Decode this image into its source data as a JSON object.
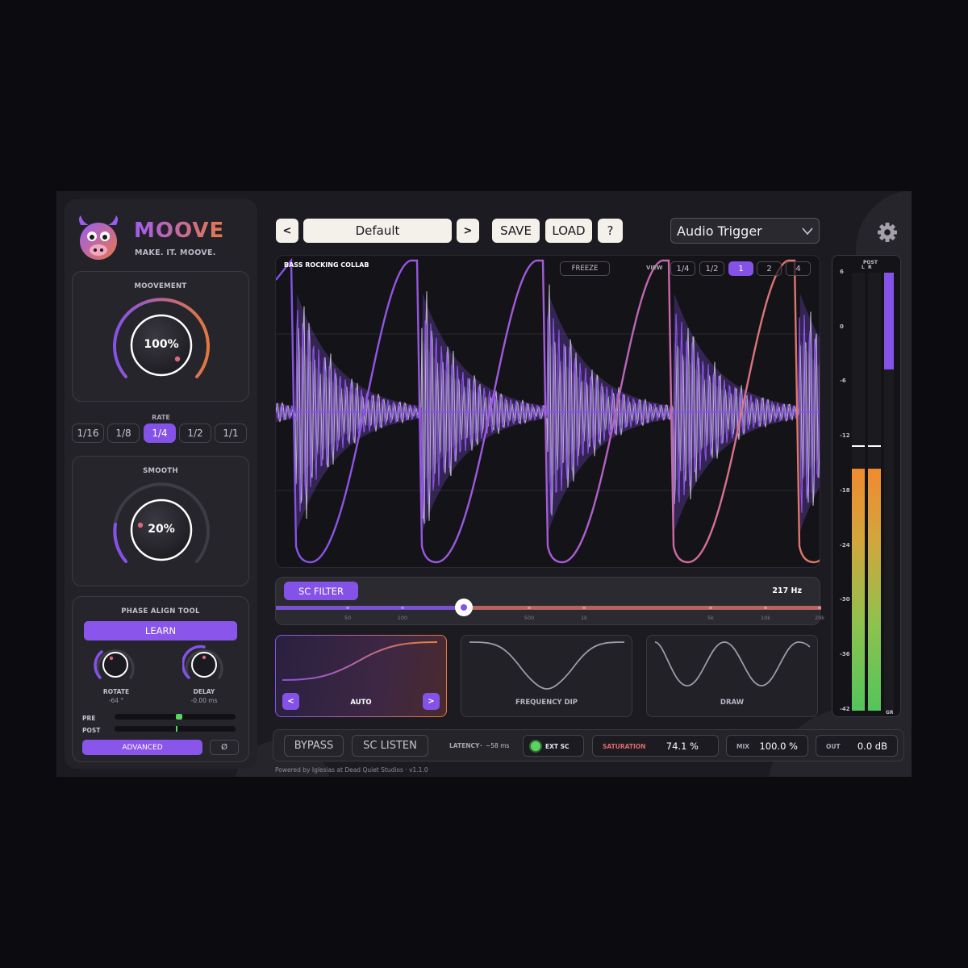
{
  "brand": {
    "name": "MOOVE",
    "tagline": "MAKE. IT. MOOVE."
  },
  "movement": {
    "title": "MOOVEMENT",
    "value": "100%",
    "level": 1.0
  },
  "rate": {
    "label": "RATE",
    "options": [
      "1/16",
      "1/8",
      "1/4",
      "1/2",
      "1/1"
    ],
    "selected": "1/4"
  },
  "smooth": {
    "title": "SMOOTH",
    "value": "20%",
    "level": 0.2
  },
  "phase": {
    "title": "PHASE ALIGN TOOL",
    "learn": "LEARN",
    "rotate": {
      "label": "ROTATE",
      "value": "-64 °"
    },
    "delay": {
      "label": "DELAY",
      "value": "-0.00 ms"
    },
    "pre": "PRE",
    "post": "POST",
    "advanced": "ADVANCED",
    "phase_invert": "Ø"
  },
  "toolbar": {
    "prev": "<",
    "preset": "Default",
    "next": ">",
    "save": "SAVE",
    "load": "LOAD",
    "help": "?"
  },
  "trigger": {
    "selected": "Audio Trigger"
  },
  "waveform": {
    "title": "BASS ROCKING COLLAB",
    "freeze": "FREEZE",
    "view_label": "VIEW",
    "view_options": [
      "1/4",
      "1/2",
      "1",
      "2",
      "4"
    ],
    "view_selected": "1"
  },
  "sc_filter": {
    "label": "SC FILTER",
    "value": "217 Hz",
    "ticks": [
      "50",
      "100",
      "500",
      "1k",
      "5k",
      "10k",
      "20k"
    ]
  },
  "shapes": {
    "auto": "AUTO",
    "frequency_dip": "FREQUENCY DIP",
    "draw": "DRAW",
    "prev": "<",
    "next": ">"
  },
  "bottom": {
    "bypass": "BYPASS",
    "sc_listen": "SC LISTEN",
    "latency_label": "LATENCY",
    "latency_value": "~58 ms",
    "ext_sc": "EXT SC",
    "saturation_label": "SATURATION",
    "saturation_value": "74.1 %",
    "mix_label": "MIX",
    "mix_value": "100.0 %",
    "out_label": "OUT",
    "out_value": "0.0 dB"
  },
  "footer": {
    "text": "Powered by Iglesias at Dead Quiet Studios  ·  v1.1.0"
  },
  "meter": {
    "post_label": "POST",
    "l_label": "L",
    "r_label": "R",
    "gr_label": "GR",
    "scale": [
      "6",
      "0",
      "-6",
      "-12",
      "-18",
      "-24",
      "-30",
      "-36",
      "-42"
    ]
  },
  "colors": {
    "accent": "#8552e8",
    "accent_orange": "#e3783f",
    "background": "#1c1b21",
    "ext_sc_led": "#5bd35f"
  },
  "icons": {
    "settings": "gear-icon",
    "dropdown": "chevron-down-icon",
    "logo": "cow-logo-icon"
  }
}
